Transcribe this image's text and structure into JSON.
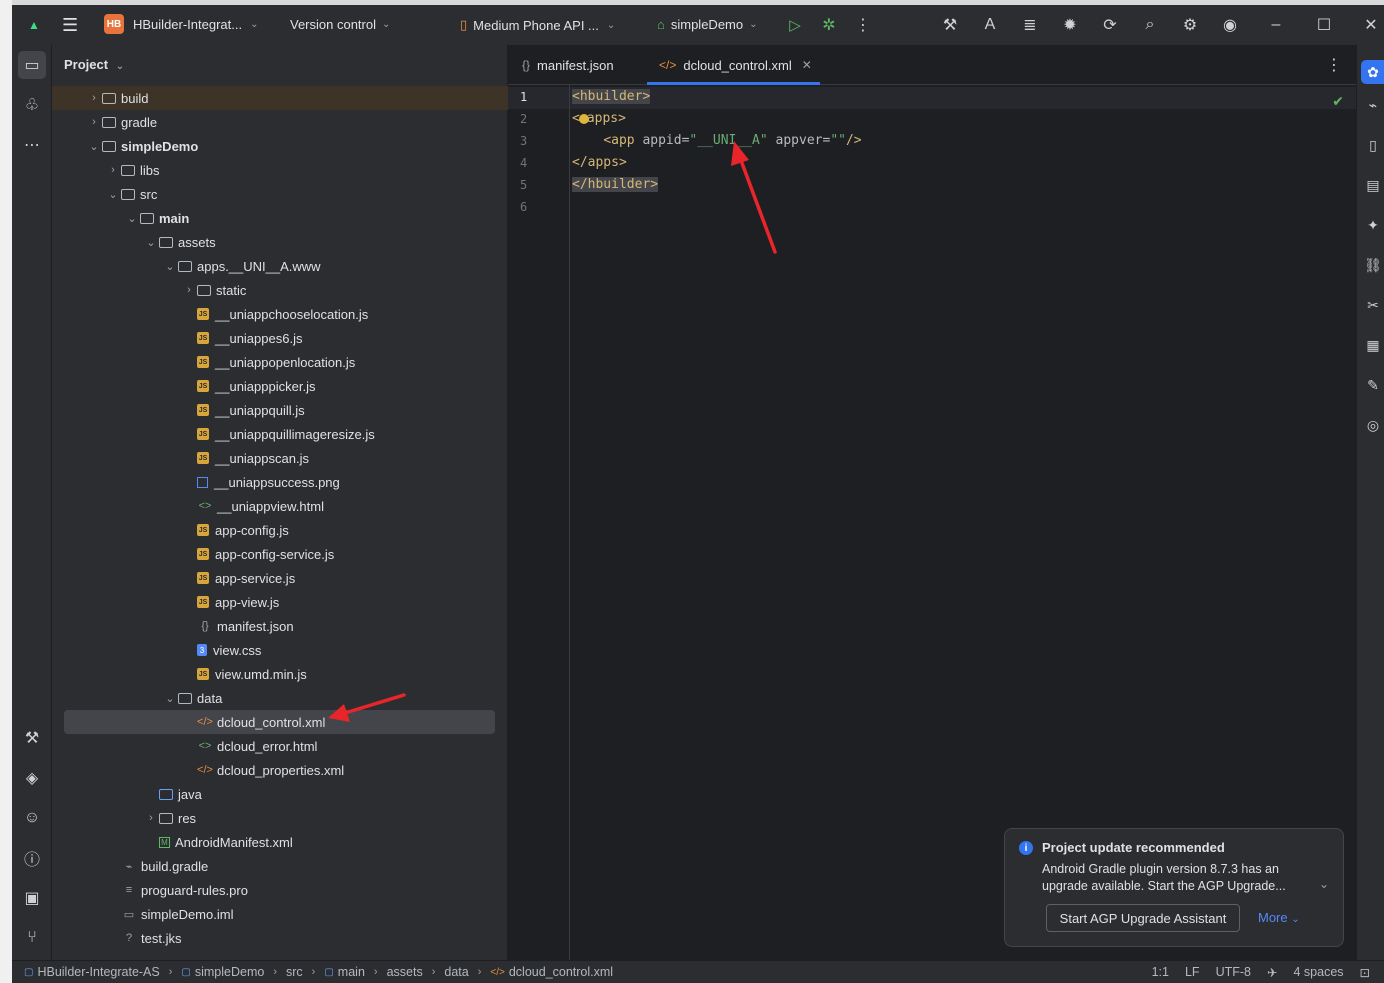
{
  "titlebar": {
    "project_badge": "HB",
    "project_name": "HBuilder-Integrat...",
    "version_control": "Version control",
    "device": "Medium Phone API ...",
    "run_config": "simpleDemo"
  },
  "project_panel": {
    "title": "Project",
    "tree": [
      {
        "label": "build",
        "depth": 0,
        "kind": "folder",
        "chevron": "›"
      },
      {
        "label": "gradle",
        "depth": 0,
        "kind": "folder",
        "chevron": "›"
      },
      {
        "label": "simpleDemo",
        "depth": 0,
        "kind": "module",
        "chevron": "⌄",
        "bold": true
      },
      {
        "label": "libs",
        "depth": 1,
        "kind": "folder",
        "chevron": "›"
      },
      {
        "label": "src",
        "depth": 1,
        "kind": "folder",
        "chevron": "⌄"
      },
      {
        "label": "main",
        "depth": 2,
        "kind": "folder",
        "chevron": "⌄",
        "bold": true
      },
      {
        "label": "assets",
        "depth": 3,
        "kind": "folder",
        "chevron": "⌄"
      },
      {
        "label": "apps.__UNI__A.www",
        "depth": 4,
        "kind": "folder",
        "chevron": "⌄"
      },
      {
        "label": "static",
        "depth": 5,
        "kind": "folder",
        "chevron": "›"
      },
      {
        "label": "__uniappchooselocation.js",
        "depth": 5,
        "kind": "js"
      },
      {
        "label": "__uniappes6.js",
        "depth": 5,
        "kind": "js"
      },
      {
        "label": "__uniappopenlocation.js",
        "depth": 5,
        "kind": "js"
      },
      {
        "label": "__uniapppicker.js",
        "depth": 5,
        "kind": "js"
      },
      {
        "label": "__uniappquill.js",
        "depth": 5,
        "kind": "js"
      },
      {
        "label": "__uniappquillimageresize.js",
        "depth": 5,
        "kind": "js"
      },
      {
        "label": "__uniappscan.js",
        "depth": 5,
        "kind": "js"
      },
      {
        "label": "__uniappsuccess.png",
        "depth": 5,
        "kind": "png"
      },
      {
        "label": "__uniappview.html",
        "depth": 5,
        "kind": "html"
      },
      {
        "label": "app-config.js",
        "depth": 5,
        "kind": "js"
      },
      {
        "label": "app-config-service.js",
        "depth": 5,
        "kind": "js"
      },
      {
        "label": "app-service.js",
        "depth": 5,
        "kind": "js"
      },
      {
        "label": "app-view.js",
        "depth": 5,
        "kind": "js"
      },
      {
        "label": "manifest.json",
        "depth": 5,
        "kind": "json"
      },
      {
        "label": "view.css",
        "depth": 5,
        "kind": "css"
      },
      {
        "label": "view.umd.min.js",
        "depth": 5,
        "kind": "js"
      },
      {
        "label": "data",
        "depth": 4,
        "kind": "folder",
        "chevron": "⌄"
      },
      {
        "label": "dcloud_control.xml",
        "depth": 5,
        "kind": "xml",
        "selected": true
      },
      {
        "label": "dcloud_error.html",
        "depth": 5,
        "kind": "html"
      },
      {
        "label": "dcloud_properties.xml",
        "depth": 5,
        "kind": "xml"
      },
      {
        "label": "java",
        "depth": 3,
        "kind": "folder-blue"
      },
      {
        "label": "res",
        "depth": 3,
        "kind": "folder",
        "chevron": "›"
      },
      {
        "label": "AndroidManifest.xml",
        "depth": 3,
        "kind": "manifest"
      },
      {
        "label": "build.gradle",
        "depth": 1,
        "kind": "gradle"
      },
      {
        "label": "proguard-rules.pro",
        "depth": 1,
        "kind": "text"
      },
      {
        "label": "simpleDemo.iml",
        "depth": 1,
        "kind": "iml"
      },
      {
        "label": "test.jks",
        "depth": 1,
        "kind": "unknown"
      }
    ]
  },
  "editor": {
    "tabs": [
      {
        "label": "manifest.json",
        "icon": "{}",
        "active": false
      },
      {
        "label": "dcloud_control.xml",
        "icon": "</>",
        "active": true
      }
    ],
    "line_numbers": [
      "1",
      "2",
      "3",
      "4",
      "5",
      "6"
    ],
    "code": {
      "l1": "<hbuilder>",
      "l2_open": "<",
      "l2_name": "apps>",
      "l3_tag_open": "<app ",
      "l3_attr1": "appid=",
      "l3_val1": "\"__UNI__A\"",
      "l3_attr2": " appver=",
      "l3_val2": "\"\"",
      "l3_tag_close": "/>",
      "l4": "</apps>",
      "l5": "</hbuilder>"
    }
  },
  "notification": {
    "title": "Project update recommended",
    "body": "Android Gradle plugin version 8.7.3 has an upgrade available. Start the AGP Upgrade...",
    "button": "Start AGP Upgrade Assistant",
    "more": "More"
  },
  "statusbar": {
    "breadcrumbs": [
      "HBuilder-Integrate-AS",
      "simpleDemo",
      "src",
      "main",
      "assets",
      "data",
      "dcloud_control.xml"
    ],
    "position": "1:1",
    "line_ending": "LF",
    "encoding": "UTF-8",
    "indent": "4 spaces"
  },
  "colors": {
    "accent": "#3574f0",
    "annotation_arrow": "#e8252a",
    "xml_tag": "#d5b778",
    "xml_value": "#6aab73"
  }
}
